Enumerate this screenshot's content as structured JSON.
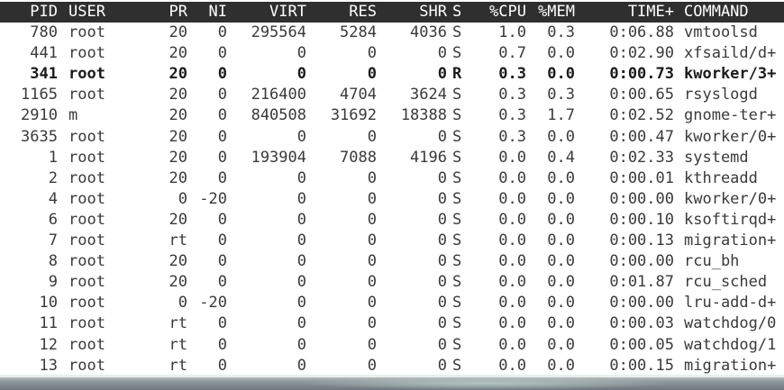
{
  "columns": [
    {
      "key": "pid",
      "label": "PID"
    },
    {
      "key": "user",
      "label": "USER"
    },
    {
      "key": "pr",
      "label": "PR"
    },
    {
      "key": "ni",
      "label": "NI"
    },
    {
      "key": "virt",
      "label": "VIRT"
    },
    {
      "key": "res",
      "label": "RES"
    },
    {
      "key": "shr",
      "label": "SHR"
    },
    {
      "key": "s",
      "label": "S"
    },
    {
      "key": "cpu",
      "label": "%CPU"
    },
    {
      "key": "mem",
      "label": "%MEM"
    },
    {
      "key": "time",
      "label": "TIME+"
    },
    {
      "key": "command",
      "label": "COMMAND"
    }
  ],
  "processes": [
    {
      "pid": "780",
      "user": "root",
      "pr": "20",
      "ni": "0",
      "virt": "295564",
      "res": "5284",
      "shr": "4036",
      "s": "S",
      "cpu": "1.0",
      "mem": "0.3",
      "time": "0:06.88",
      "command": "vmtoolsd",
      "highlighted": false
    },
    {
      "pid": "441",
      "user": "root",
      "pr": "20",
      "ni": "0",
      "virt": "0",
      "res": "0",
      "shr": "0",
      "s": "S",
      "cpu": "0.7",
      "mem": "0.0",
      "time": "0:02.90",
      "command": "xfsaild/d+",
      "highlighted": false
    },
    {
      "pid": "341",
      "user": "root",
      "pr": "20",
      "ni": "0",
      "virt": "0",
      "res": "0",
      "shr": "0",
      "s": "R",
      "cpu": "0.3",
      "mem": "0.0",
      "time": "0:00.73",
      "command": "kworker/3+",
      "highlighted": true
    },
    {
      "pid": "1165",
      "user": "root",
      "pr": "20",
      "ni": "0",
      "virt": "216400",
      "res": "4704",
      "shr": "3624",
      "s": "S",
      "cpu": "0.3",
      "mem": "0.3",
      "time": "0:00.65",
      "command": "rsyslogd",
      "highlighted": false
    },
    {
      "pid": "2910",
      "user": "m",
      "pr": "20",
      "ni": "0",
      "virt": "840508",
      "res": "31692",
      "shr": "18388",
      "s": "S",
      "cpu": "0.3",
      "mem": "1.7",
      "time": "0:02.52",
      "command": "gnome-ter+",
      "highlighted": false
    },
    {
      "pid": "3635",
      "user": "root",
      "pr": "20",
      "ni": "0",
      "virt": "0",
      "res": "0",
      "shr": "0",
      "s": "S",
      "cpu": "0.3",
      "mem": "0.0",
      "time": "0:00.47",
      "command": "kworker/0+",
      "highlighted": false
    },
    {
      "pid": "1",
      "user": "root",
      "pr": "20",
      "ni": "0",
      "virt": "193904",
      "res": "7088",
      "shr": "4196",
      "s": "S",
      "cpu": "0.0",
      "mem": "0.4",
      "time": "0:02.33",
      "command": "systemd",
      "highlighted": false
    },
    {
      "pid": "2",
      "user": "root",
      "pr": "20",
      "ni": "0",
      "virt": "0",
      "res": "0",
      "shr": "0",
      "s": "S",
      "cpu": "0.0",
      "mem": "0.0",
      "time": "0:00.01",
      "command": "kthreadd",
      "highlighted": false
    },
    {
      "pid": "4",
      "user": "root",
      "pr": "0",
      "ni": "-20",
      "virt": "0",
      "res": "0",
      "shr": "0",
      "s": "S",
      "cpu": "0.0",
      "mem": "0.0",
      "time": "0:00.00",
      "command": "kworker/0+",
      "highlighted": false
    },
    {
      "pid": "6",
      "user": "root",
      "pr": "20",
      "ni": "0",
      "virt": "0",
      "res": "0",
      "shr": "0",
      "s": "S",
      "cpu": "0.0",
      "mem": "0.0",
      "time": "0:00.10",
      "command": "ksoftirqd+",
      "highlighted": false
    },
    {
      "pid": "7",
      "user": "root",
      "pr": "rt",
      "ni": "0",
      "virt": "0",
      "res": "0",
      "shr": "0",
      "s": "S",
      "cpu": "0.0",
      "mem": "0.0",
      "time": "0:00.13",
      "command": "migration+",
      "highlighted": false
    },
    {
      "pid": "8",
      "user": "root",
      "pr": "20",
      "ni": "0",
      "virt": "0",
      "res": "0",
      "shr": "0",
      "s": "S",
      "cpu": "0.0",
      "mem": "0.0",
      "time": "0:00.00",
      "command": "rcu_bh",
      "highlighted": false
    },
    {
      "pid": "9",
      "user": "root",
      "pr": "20",
      "ni": "0",
      "virt": "0",
      "res": "0",
      "shr": "0",
      "s": "S",
      "cpu": "0.0",
      "mem": "0.0",
      "time": "0:01.87",
      "command": "rcu_sched",
      "highlighted": false
    },
    {
      "pid": "10",
      "user": "root",
      "pr": "0",
      "ni": "-20",
      "virt": "0",
      "res": "0",
      "shr": "0",
      "s": "S",
      "cpu": "0.0",
      "mem": "0.0",
      "time": "0:00.00",
      "command": "lru-add-d+",
      "highlighted": false
    },
    {
      "pid": "11",
      "user": "root",
      "pr": "rt",
      "ni": "0",
      "virt": "0",
      "res": "0",
      "shr": "0",
      "s": "S",
      "cpu": "0.0",
      "mem": "0.0",
      "time": "0:00.03",
      "command": "watchdog/0",
      "highlighted": false
    },
    {
      "pid": "12",
      "user": "root",
      "pr": "rt",
      "ni": "0",
      "virt": "0",
      "res": "0",
      "shr": "0",
      "s": "S",
      "cpu": "0.0",
      "mem": "0.0",
      "time": "0:00.05",
      "command": "watchdog/1",
      "highlighted": false
    },
    {
      "pid": "13",
      "user": "root",
      "pr": "rt",
      "ni": "0",
      "virt": "0",
      "res": "0",
      "shr": "0",
      "s": "S",
      "cpu": "0.0",
      "mem": "0.0",
      "time": "0:00.15",
      "command": "migration+",
      "highlighted": false
    }
  ],
  "colors": {
    "header_bg": "#2f2f2f",
    "header_fg": "#ffffff",
    "text": "#3a3a3a",
    "background": "#ffffff"
  }
}
